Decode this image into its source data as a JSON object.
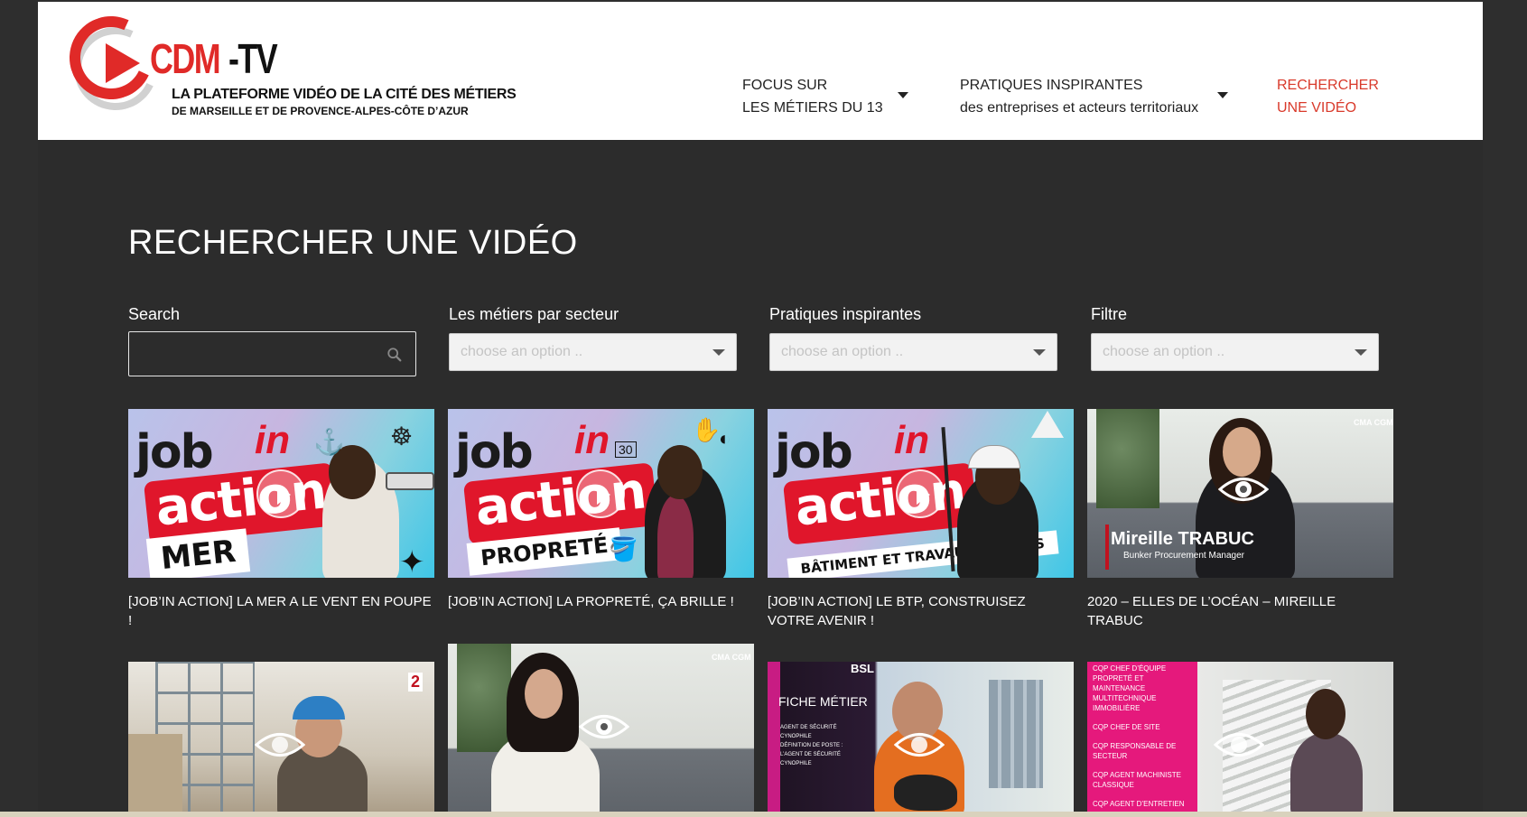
{
  "brand": {
    "logo_name": "CDM",
    "logo_suffix": "-TV",
    "tagline": "LA PLATEFORME VIDÉO DE LA CITÉ DES MÉTIERS",
    "subtagline": "DE MARSEILLE ET DE PROVENCE-ALPES-CÔTE D’AZUR",
    "accent_color": "#e02a28"
  },
  "nav": {
    "focus_line1": "FOCUS SUR",
    "focus_line2": "LES MÉTIERS DU 13",
    "pratiques_line1": "PRATIQUES INSPIRANTES",
    "pratiques_line2": "des entreprises et acteurs territoriaux",
    "search_line1": "RECHERCHER",
    "search_line2": "UNE VIDÉO"
  },
  "page_title": "RECHERCHER UNE VIDÉO",
  "filters": {
    "search_label": "Search",
    "search_value": "",
    "secteur_label": "Les métiers par secteur",
    "pratiques_label": "Pratiques inspirantes",
    "filtre_label": "Filtre",
    "placeholder": "choose an option .."
  },
  "videos": [
    {
      "title": "[JOB’IN ACTION] LA MER A LE VENT EN POUPE !",
      "thumb_text": "job`in action",
      "tag": "MER",
      "icon": "play-icon"
    },
    {
      "title": "[JOB’IN ACTION] LA PROPRETÉ, ÇA BRILLE !",
      "thumb_text": "job`in action",
      "tag": "PROPRETÉ",
      "icon": "play-icon"
    },
    {
      "title": "[JOB’IN ACTION] LE BTP, CONSTRUISEZ VOTRE AVENIR !",
      "thumb_text": "job`in action",
      "tag": "BÂTIMENT ET TRAVAUX PUBLICS",
      "icon": "play-icon"
    },
    {
      "title": "2020 – ELLES DE L’OCÉAN – MIREILLE TRABUC",
      "thumb_name": "Mireille TRABUC",
      "thumb_role": "Bunker Procurement Manager",
      "thumb_logo": "CMA CGM",
      "icon": "eye-icon"
    },
    {
      "title": "",
      "thumb_logo": "2",
      "icon": "eye-icon"
    },
    {
      "title": "",
      "thumb_logo": "CMA CGM",
      "icon": "eye-icon"
    },
    {
      "title": "",
      "thumb_heading": "FICHE MÉTIER",
      "thumb_logo": "BSL",
      "thumb_lines": [
        "AGENT DE SÉCURITÉ CYNOPHILE",
        "DÉFINITION DE POSTE :",
        "L’AGENT DE SÉCURITÉ CYNOPHILE"
      ],
      "icon": "eye-icon"
    },
    {
      "title": "",
      "thumb_lines": [
        "CQP CHEF D’ÉQUIPE PROPRETÉ ET MAINTENANCE MULTITECHNIQUE IMMOBILIÈRE",
        "CQP CHEF DE SITE",
        "CQP RESPONSABLE DE SECTEUR",
        "CQP AGENT MACHINISTE CLASSIQUE",
        "CQP AGENT D’ENTRETIEN"
      ],
      "icon": "eye-icon"
    }
  ]
}
